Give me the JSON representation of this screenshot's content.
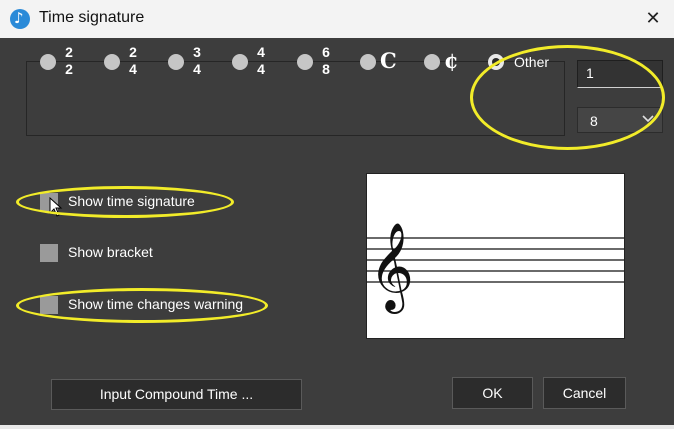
{
  "window": {
    "title": "Time signature",
    "close_icon": "✕"
  },
  "time_signatures": [
    {
      "id": "2-2",
      "top": "2",
      "bottom": "2",
      "selected": false
    },
    {
      "id": "2-4",
      "top": "2",
      "bottom": "4",
      "selected": false
    },
    {
      "id": "3-4",
      "top": "3",
      "bottom": "4",
      "selected": false
    },
    {
      "id": "4-4",
      "top": "4",
      "bottom": "4",
      "selected": false
    },
    {
      "id": "6-8",
      "top": "6",
      "bottom": "8",
      "selected": false
    },
    {
      "id": "common",
      "symbol": "𝄴",
      "display": "C",
      "selected": false
    },
    {
      "id": "cut",
      "display": "¢",
      "selected": false
    },
    {
      "id": "other",
      "label": "Other",
      "selected": true
    }
  ],
  "other": {
    "numerator": "1",
    "denominator": "8"
  },
  "options": {
    "show_time_signature": "Show time signature",
    "show_bracket": "Show bracket",
    "show_time_changes_warning": "Show time changes warning"
  },
  "buttons": {
    "compound": "Input Compound Time ...",
    "ok": "OK",
    "cancel": "Cancel"
  },
  "colors": {
    "dialog_bg": "#3d3d3d",
    "highlight": "#f2ec29",
    "checkbox": "#9a9a9a",
    "radio": "#c6c6c6"
  }
}
